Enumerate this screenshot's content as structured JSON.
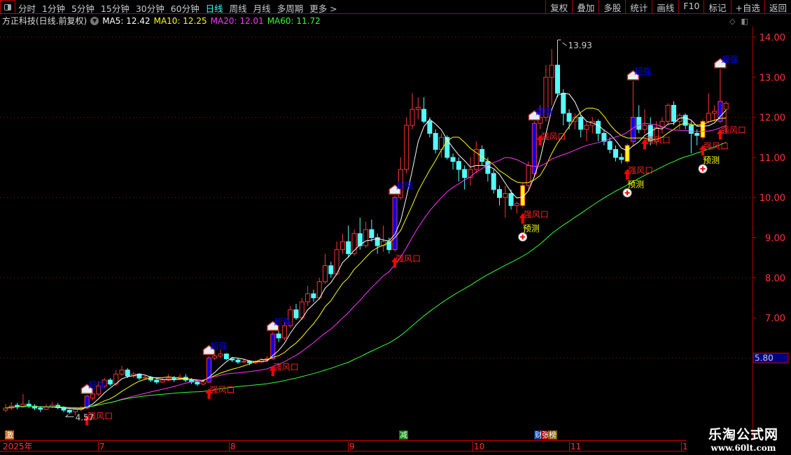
{
  "toolbar": {
    "periods": [
      "分时",
      "1分钟",
      "5分钟",
      "15分钟",
      "30分钟",
      "60分钟",
      "日线",
      "周线",
      "月线",
      "多周期",
      "更多 >"
    ],
    "active_period": "日线",
    "right_buttons": [
      "复权",
      "叠加",
      "多股",
      "统计",
      "画线",
      "F10",
      "标记",
      "+自选",
      "返回"
    ]
  },
  "info": {
    "title": "方正科技(日线.前复权)",
    "ma5": "MA5: 12.42",
    "ma10": "MA10: 12.25",
    "ma20": "MA20: 12.01",
    "ma60": "MA60: 11.72"
  },
  "colors": {
    "up": "#ff3333",
    "down": "#54ffff",
    "ma5": "#ffffff",
    "ma10": "#ffff00",
    "ma20": "#ff33ff",
    "ma60": "#33ff33",
    "strong": "#0000ff",
    "signal": "#ffff00"
  },
  "time_axis": [
    "2025年",
    "7",
    "8",
    "9",
    "10",
    "11",
    "1"
  ],
  "bottom_tags": [
    {
      "text": "激",
      "color": "#c85a00"
    },
    {
      "text": "减",
      "color": "#008000"
    },
    {
      "text": "财",
      "color": "#003399"
    },
    {
      "text": "张",
      "color": "#aa0000"
    },
    {
      "text": "榜",
      "color": "#8a5a00"
    }
  ],
  "watermark": {
    "title": "乐淘公式网",
    "url": "www.60lt.com"
  },
  "chart_data": {
    "type": "candlestick",
    "yaxis_ticks": [
      "14.00",
      "13.00",
      "12.00",
      "11.00",
      "10.00",
      "9.00",
      "8.00",
      "7.00"
    ],
    "ylim": [
      4.3,
      14.3
    ],
    "price_tag": "5.80",
    "annotations": {
      "high": "13.93",
      "low": "4.57"
    },
    "signal_labels": {
      "strong": "超强",
      "wind": "强风口",
      "predict": "预测"
    },
    "candles": [
      [
        4.7,
        4.85,
        4.65,
        4.75
      ],
      [
        4.75,
        4.9,
        4.7,
        4.8
      ],
      [
        4.82,
        4.88,
        4.72,
        4.78
      ],
      [
        4.78,
        5.1,
        4.75,
        4.85
      ],
      [
        4.85,
        4.95,
        4.75,
        4.8
      ],
      [
        4.8,
        4.85,
        4.7,
        4.75
      ],
      [
        4.75,
        4.8,
        4.65,
        4.72
      ],
      [
        4.72,
        4.85,
        4.7,
        4.78
      ],
      [
        4.78,
        4.9,
        4.75,
        4.82
      ],
      [
        4.82,
        4.88,
        4.72,
        4.76
      ],
      [
        4.76,
        4.8,
        4.65,
        4.7
      ],
      [
        4.7,
        4.72,
        4.6,
        4.65
      ],
      [
        4.66,
        4.78,
        4.57,
        4.72
      ],
      [
        4.72,
        4.8,
        4.68,
        4.75
      ],
      [
        4.75,
        5.08,
        4.72,
        5.05
      ],
      [
        5.0,
        5.2,
        4.95,
        5.1
      ],
      [
        5.1,
        5.4,
        5.05,
        5.3
      ],
      [
        5.3,
        5.5,
        5.25,
        5.45
      ],
      [
        5.45,
        5.5,
        5.3,
        5.35
      ],
      [
        5.35,
        5.7,
        5.3,
        5.6
      ],
      [
        5.6,
        5.8,
        5.55,
        5.7
      ],
      [
        5.7,
        5.75,
        5.5,
        5.55
      ],
      [
        5.55,
        5.65,
        5.5,
        5.6
      ],
      [
        5.6,
        5.62,
        5.45,
        5.5
      ],
      [
        5.5,
        5.58,
        5.45,
        5.52
      ],
      [
        5.52,
        5.55,
        5.4,
        5.45
      ],
      [
        5.45,
        5.48,
        5.35,
        5.4
      ],
      [
        5.4,
        5.5,
        5.38,
        5.45
      ],
      [
        5.45,
        5.6,
        5.42,
        5.5
      ],
      [
        5.5,
        5.55,
        5.4,
        5.48
      ],
      [
        5.48,
        5.6,
        5.45,
        5.52
      ],
      [
        5.52,
        5.6,
        5.4,
        5.45
      ],
      [
        5.45,
        5.5,
        5.35,
        5.4
      ],
      [
        5.4,
        5.45,
        5.3,
        5.35
      ],
      [
        5.35,
        5.45,
        5.32,
        5.4
      ],
      [
        5.4,
        6.05,
        5.38,
        6.0
      ],
      [
        6.0,
        6.15,
        5.95,
        6.05
      ],
      [
        6.05,
        6.2,
        6.0,
        6.1
      ],
      [
        6.1,
        6.12,
        5.95,
        5.98
      ],
      [
        5.98,
        6.02,
        5.9,
        5.95
      ],
      [
        5.95,
        6.0,
        5.85,
        5.9
      ],
      [
        5.9,
        5.98,
        5.88,
        5.92
      ],
      [
        5.92,
        5.95,
        5.82,
        5.88
      ],
      [
        5.88,
        5.95,
        5.85,
        5.9
      ],
      [
        5.9,
        6.0,
        5.88,
        5.95
      ],
      [
        5.95,
        6.05,
        5.9,
        5.98
      ],
      [
        5.98,
        6.65,
        5.95,
        6.6
      ],
      [
        6.6,
        6.7,
        6.4,
        6.5
      ],
      [
        6.5,
        6.9,
        6.45,
        6.8
      ],
      [
        6.8,
        7.3,
        6.75,
        7.2
      ],
      [
        7.2,
        7.35,
        6.95,
        7.0
      ],
      [
        7.0,
        7.5,
        6.95,
        7.4
      ],
      [
        7.4,
        7.8,
        7.3,
        7.6
      ],
      [
        7.6,
        7.7,
        7.4,
        7.5
      ],
      [
        7.5,
        8.0,
        7.45,
        7.9
      ],
      [
        7.9,
        8.6,
        7.85,
        8.3
      ],
      [
        8.3,
        8.4,
        8.0,
        8.1
      ],
      [
        8.1,
        8.9,
        8.05,
        8.7
      ],
      [
        8.7,
        9.1,
        8.6,
        8.9
      ],
      [
        8.9,
        9.3,
        8.5,
        8.6
      ],
      [
        8.6,
        9.2,
        8.55,
        9.1
      ],
      [
        9.1,
        9.5,
        8.7,
        8.8
      ],
      [
        8.8,
        9.4,
        8.75,
        9.2
      ],
      [
        9.2,
        9.45,
        8.9,
        9.0
      ],
      [
        9.0,
        9.1,
        8.6,
        8.8
      ],
      [
        8.8,
        9.3,
        8.65,
        8.9
      ],
      [
        8.9,
        9.0,
        8.6,
        8.7
      ],
      [
        8.7,
        10.05,
        8.65,
        10.0
      ],
      [
        10.0,
        11.0,
        9.95,
        10.7
      ],
      [
        10.7,
        12.0,
        10.6,
        11.8
      ],
      [
        11.8,
        12.6,
        11.7,
        12.2
      ],
      [
        12.2,
        12.5,
        11.95,
        12.25
      ],
      [
        12.2,
        12.5,
        11.85,
        11.9
      ],
      [
        11.9,
        12.0,
        11.5,
        11.6
      ],
      [
        11.6,
        11.7,
        11.1,
        11.2
      ],
      [
        11.2,
        11.6,
        11.0,
        11.5
      ],
      [
        11.5,
        11.55,
        10.95,
        11.0
      ],
      [
        11.0,
        11.1,
        10.7,
        10.9
      ],
      [
        10.9,
        11.0,
        10.4,
        10.7
      ],
      [
        10.7,
        10.8,
        10.2,
        10.5
      ],
      [
        10.5,
        11.0,
        10.3,
        10.7
      ],
      [
        10.7,
        11.4,
        10.6,
        11.2
      ],
      [
        11.2,
        11.3,
        10.8,
        10.9
      ],
      [
        10.9,
        11.0,
        10.4,
        10.6
      ],
      [
        10.6,
        10.7,
        10.1,
        10.2
      ],
      [
        10.2,
        10.3,
        9.8,
        10.0
      ],
      [
        10.0,
        10.3,
        9.5,
        10.1
      ],
      [
        10.1,
        10.2,
        9.7,
        9.8
      ],
      [
        9.8,
        9.9,
        9.6,
        9.85
      ],
      [
        9.8,
        10.35,
        9.75,
        10.3
      ],
      [
        10.3,
        10.9,
        10.2,
        10.8
      ],
      [
        10.6,
        11.9,
        10.5,
        11.85
      ],
      [
        11.85,
        12.3,
        11.7,
        12.0
      ],
      [
        12.0,
        13.3,
        11.9,
        13.0
      ],
      [
        13.0,
        13.7,
        12.3,
        13.3
      ],
      [
        13.3,
        13.93,
        12.5,
        12.6
      ],
      [
        12.6,
        12.7,
        11.8,
        12.1
      ],
      [
        12.1,
        12.2,
        11.7,
        11.9
      ],
      [
        11.9,
        12.1,
        11.7,
        12.0
      ],
      [
        12.0,
        12.05,
        11.5,
        11.7
      ],
      [
        11.7,
        11.9,
        11.4,
        11.8
      ],
      [
        11.8,
        12.0,
        11.6,
        11.9
      ],
      [
        11.9,
        11.95,
        11.4,
        11.6
      ],
      [
        11.6,
        11.7,
        11.3,
        11.4
      ],
      [
        11.4,
        11.5,
        11.1,
        11.2
      ],
      [
        11.2,
        11.3,
        10.9,
        11.0
      ],
      [
        11.0,
        11.1,
        10.85,
        10.95
      ],
      [
        10.9,
        11.35,
        10.85,
        11.3
      ],
      [
        11.4,
        12.9,
        11.3,
        12.0
      ],
      [
        12.0,
        12.3,
        11.6,
        11.7
      ],
      [
        11.7,
        12.2,
        11.6,
        11.8
      ],
      [
        11.8,
        12.0,
        11.3,
        11.4
      ],
      [
        11.4,
        11.9,
        11.3,
        11.75
      ],
      [
        11.75,
        12.0,
        11.6,
        11.9
      ],
      [
        11.9,
        12.35,
        11.8,
        12.3
      ],
      [
        12.3,
        12.4,
        11.8,
        11.9
      ],
      [
        11.9,
        12.1,
        11.7,
        12.05
      ],
      [
        12.05,
        12.1,
        11.7,
        11.8
      ],
      [
        11.8,
        11.9,
        11.1,
        11.6
      ],
      [
        11.6,
        11.7,
        11.3,
        11.55
      ],
      [
        11.5,
        11.95,
        11.45,
        11.9
      ],
      [
        11.9,
        12.6,
        11.85,
        12.1
      ],
      [
        12.1,
        12.3,
        11.9,
        12.15
      ],
      [
        11.9,
        13.2,
        11.85,
        12.4
      ],
      [
        12.2,
        12.4,
        11.6,
        12.35
      ]
    ],
    "strong_bars": [
      14,
      35,
      46,
      67,
      91,
      108,
      123
    ],
    "yellow_bars": [
      89,
      107,
      120
    ],
    "wind_signals": [
      14,
      35,
      46,
      67,
      89,
      92,
      107,
      110,
      120,
      123
    ],
    "predict_signals": [
      89,
      107,
      120
    ],
    "ma_periods": [
      5,
      10,
      20,
      60
    ]
  }
}
